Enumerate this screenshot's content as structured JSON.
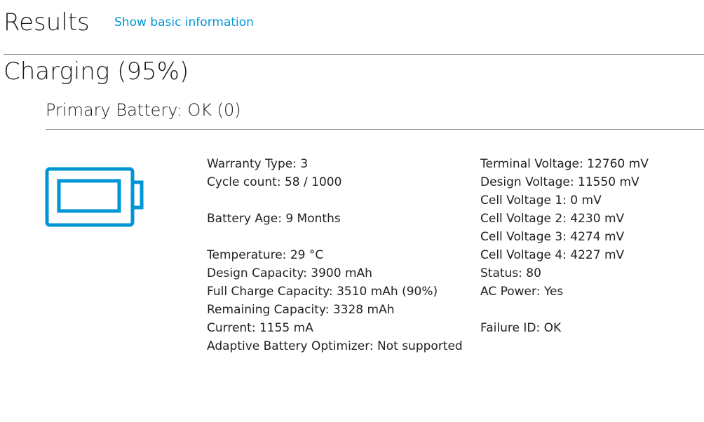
{
  "header": {
    "title": "Results",
    "toggle_link": "Show basic information"
  },
  "status": {
    "heading": "Charging (95%)"
  },
  "battery": {
    "heading": "Primary Battery: OK (0)",
    "icon": "battery-icon",
    "accent_color": "#0096d6",
    "left_column": [
      "Warranty Type: 3",
      "Cycle count: 58 / 1000",
      "",
      "Battery Age: 9 Months",
      "",
      "Temperature: 29 °C",
      "Design Capacity: 3900 mAh",
      "Full Charge Capacity: 3510 mAh (90%)",
      "Remaining Capacity: 3328 mAh",
      "Current: 1155 mA",
      "Adaptive Battery Optimizer: Not supported"
    ],
    "right_column": [
      "Terminal Voltage: 12760 mV",
      "Design Voltage: 11550 mV",
      "Cell Voltage 1: 0 mV",
      "Cell Voltage 2: 4230 mV",
      "Cell Voltage 3: 4274 mV",
      "Cell Voltage 4: 4227 mV",
      "Status: 80",
      "AC Power: Yes",
      "",
      "Failure ID: OK"
    ]
  }
}
